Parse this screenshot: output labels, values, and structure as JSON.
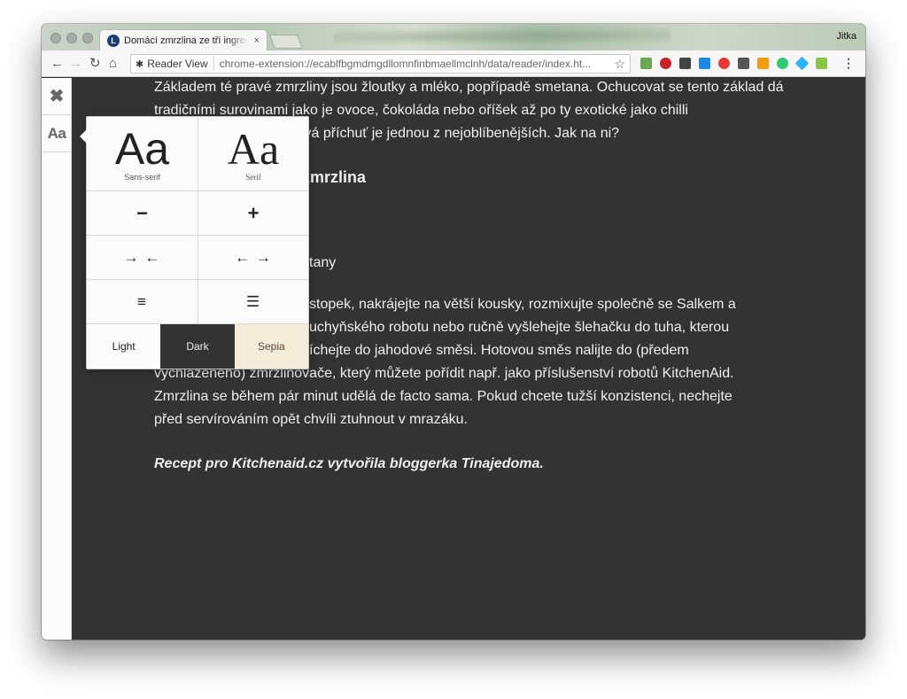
{
  "browser": {
    "tab_title": "Domácí zmrzlina ze tří ingrediencí",
    "tab_favicon": "L",
    "tab_close": "×",
    "profile_name": "Jitka",
    "url_chip_label": "Reader View",
    "url": "chrome-extension://ecablfbgmdmgdllomnfinbmaellmclnh/data/reader/index.ht...",
    "star_icon": "☆",
    "extension_icons": [
      "evernote-icon",
      "pinterest-icon",
      "film-icon",
      "onetab-icon",
      "opera-icon",
      "pocket-icon",
      "mail-icon",
      "speech-bubble-icon",
      "diamond-icon",
      "notes-icon"
    ],
    "extension_colors": [
      "#6aa84f",
      "#cb2027",
      "#444444",
      "#1e88e5",
      "#e53935",
      "#555555",
      "#f39c12",
      "#2ecc71",
      "#29b6f6",
      "#8bc34a"
    ]
  },
  "sidebar": {
    "close_icon": "✖",
    "font_button_label": "Aa"
  },
  "article": {
    "p1": "Základem té pravé zmrzliny jsou žloutky a mléko, popřípadě smetana. Ochucovat se tento základ dá tradičními surovinami jako je ovoce, čokoláda nebo oříšek až po ty exotické jako chilli",
    "p1_line3": "ahodová příchuť je jednou z nejoblíbenějších. Jak na ni?",
    "heading": "zmrzlina",
    "ingredient_frag": "tany",
    "p2_line1": "stopek, nakrájejte na větší kousky, rozmixujte společně se Salkem a",
    "p2_line2": "uchyňského robotu nebo ručně vyšlehejte šlehačku do tuha, kterou",
    "p2_line3": "íchejte do jahodové směsi. Hotovou směs nalijte do (předem",
    "p2_line4": "vychlazeného) zmrzlinovače, který můžete pořídit např. jako příslušenství robotů KitchenAid.",
    "p2_line5": "Zmrzlina se během pár minut udělá de facto sama. Pokud chcete tužší konzistenci, nechejte",
    "p2_line6": "před servírováním opět chvíli ztuhnout v mrazáku.",
    "credit": "Recept pro Kitchenaid.cz vytvořila bloggerka Tinajedoma."
  },
  "popup": {
    "sans_sample": "Aa",
    "sans_label": "Sans-serif",
    "serif_sample": "Aa",
    "serif_label": "Serif",
    "decrease_icon": "−",
    "increase_icon": "+",
    "narrow_icon": "→ ←",
    "widen_icon": "← →",
    "line_height_tight_icon": "≡",
    "line_height_loose_icon": "☰",
    "theme_light": "Light",
    "theme_dark": "Dark",
    "theme_sepia": "Sepia",
    "theme_colors": {
      "light": "#fbfbfb",
      "dark": "#333333",
      "sepia": "#f4ecd8"
    }
  }
}
